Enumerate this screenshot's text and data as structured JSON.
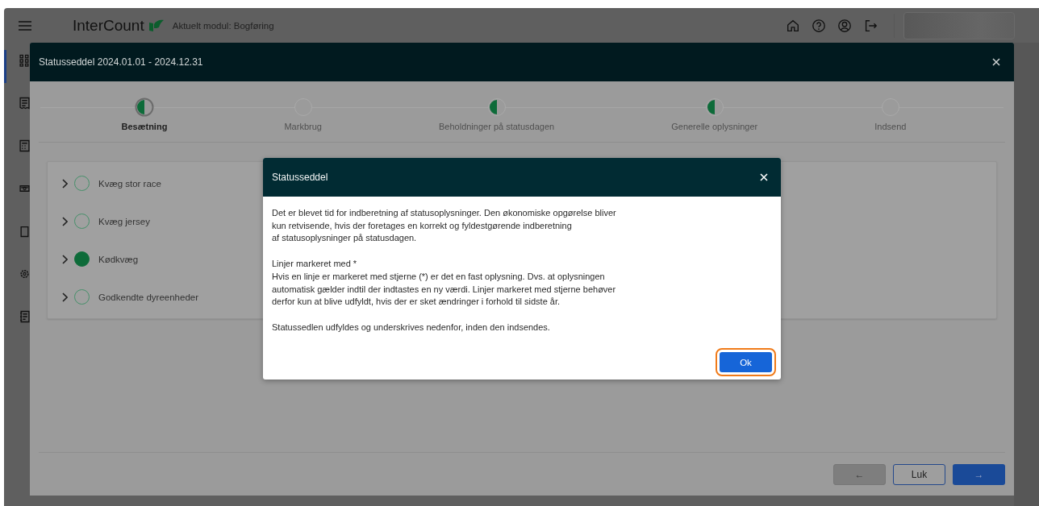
{
  "header": {
    "brand": "InterCount",
    "module": "Aktuelt modul: Bogføring"
  },
  "dialog": {
    "title": "Statusseddel 2024.01.01 - 2024.12.31",
    "steps": [
      {
        "label": "Besætning",
        "partial": true,
        "selected": true
      },
      {
        "label": "Markbrug",
        "partial": false,
        "selected": false
      },
      {
        "label": "Beholdninger på statusdagen",
        "partial": true,
        "selected": false
      },
      {
        "label": "Generelle oplysninger",
        "partial": true,
        "selected": false
      },
      {
        "label": "Indsend",
        "partial": false,
        "selected": false
      }
    ],
    "groups": [
      {
        "label": "Kvæg stor race",
        "filled": false
      },
      {
        "label": "Kvæg jersey",
        "filled": false
      },
      {
        "label": "Kødkvæg",
        "filled": true
      },
      {
        "label": "Godkendte dyreenheder",
        "filled": false
      }
    ],
    "buttons": {
      "back": "←",
      "close": "Luk",
      "next": "→"
    }
  },
  "modal": {
    "title": "Statusseddel",
    "paragraphs": [
      "Det er blevet tid for indberetning af statusoplysninger. Den økonomiske opgørelse bliver\nkun retvisende, hvis der foretages en korrekt og fyldestgørende indberetning\naf statusoplysninger på statusdagen.",
      "Linjer markeret med *\nHvis en linje er markeret med stjerne (*) er det en fast oplysning. Dvs. at oplysningen\nautomatisk gælder indtil der indtastes en ny værdi. Linjer markeret med stjerne behøver\nderfor kun at blive udfyldt, hvis der er sket ændringer i forhold til sidste år.",
      "Statussedlen udfyldes og underskrives nedenfor, inden den indsendes."
    ],
    "ok": "Ok"
  }
}
